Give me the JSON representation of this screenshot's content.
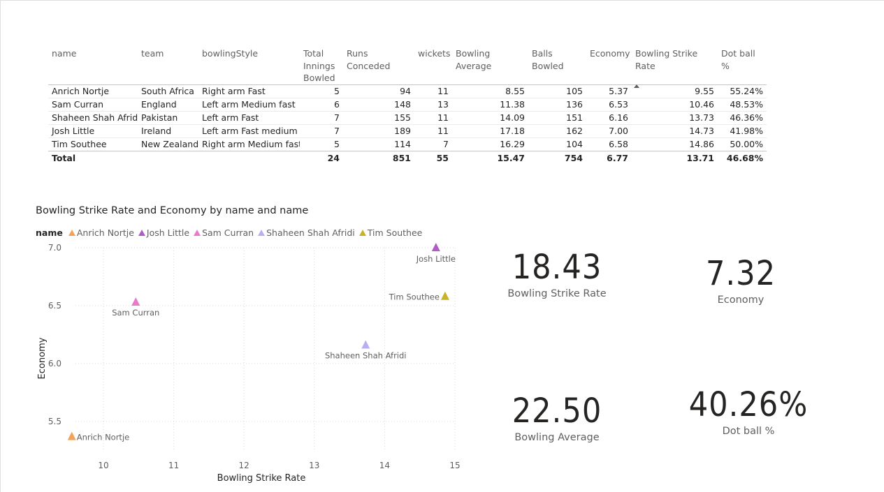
{
  "table": {
    "columns": [
      "name",
      "team",
      "bowlingStyle",
      "Total Innings Bowled",
      "Runs Conceded",
      "wickets",
      "Bowling Average",
      "Balls Bowled",
      "Economy",
      "Bowling Strike Rate",
      "Dot ball %"
    ],
    "rows": [
      [
        "Anrich Nortje",
        "South Africa",
        "Right arm Fast",
        "5",
        "94",
        "11",
        "8.55",
        "105",
        "5.37",
        "9.55",
        "55.24%"
      ],
      [
        "Sam Curran",
        "England",
        "Left arm Medium fast",
        "6",
        "148",
        "13",
        "11.38",
        "136",
        "6.53",
        "10.46",
        "48.53%"
      ],
      [
        "Shaheen Shah Afridi",
        "Pakistan",
        "Left arm Fast",
        "7",
        "155",
        "11",
        "14.09",
        "151",
        "6.16",
        "13.73",
        "46.36%"
      ],
      [
        "Josh Little",
        "Ireland",
        "Left arm Fast medium",
        "7",
        "189",
        "11",
        "17.18",
        "162",
        "7.00",
        "14.73",
        "41.98%"
      ],
      [
        "Tim Southee",
        "New Zealand",
        "Right arm Medium fast",
        "5",
        "114",
        "7",
        "16.29",
        "104",
        "6.58",
        "14.86",
        "50.00%"
      ]
    ],
    "total": [
      "Total",
      "",
      "",
      "24",
      "851",
      "55",
      "15.47",
      "754",
      "6.77",
      "13.71",
      "46.68%"
    ]
  },
  "chart": {
    "title": "Bowling Strike Rate and Economy by name and name",
    "legend_title": "name",
    "legend": [
      "Anrich Nortje",
      "Josh Little",
      "Sam Curran",
      "Shaheen Shah Afridi",
      "Tim Southee"
    ]
  },
  "chart_data": {
    "type": "scatter",
    "title": "Bowling Strike Rate and Economy by name and name",
    "xlabel": "Bowling Strike Rate",
    "ylabel": "Economy",
    "xlim": [
      9.5,
      15
    ],
    "ylim": [
      5.25,
      7.0
    ],
    "xticks": [
      "10",
      "11",
      "12",
      "13",
      "14",
      "15"
    ],
    "yticks": [
      "5.5",
      "6.0",
      "6.5",
      "7.0"
    ],
    "grid": true,
    "legend_position": "top-left",
    "series": [
      {
        "name": "Anrich Nortje",
        "color": "#F2A25B",
        "x": 9.55,
        "y": 5.37
      },
      {
        "name": "Josh Little",
        "color": "#B05CC7",
        "x": 14.73,
        "y": 7.0
      },
      {
        "name": "Sam Curran",
        "color": "#E87BC9",
        "x": 10.46,
        "y": 6.53
      },
      {
        "name": "Shaheen Shah Afridi",
        "color": "#B8AEF0",
        "x": 13.73,
        "y": 6.16
      },
      {
        "name": "Tim Southee",
        "color": "#C9B227",
        "x": 14.86,
        "y": 6.58
      }
    ]
  },
  "cards": [
    {
      "value": "18.43",
      "label": "Bowling Strike Rate"
    },
    {
      "value": "7.32",
      "label": "Economy"
    },
    {
      "value": "22.50",
      "label": "Bowling Average"
    },
    {
      "value": "40.26%",
      "label": "Dot ball %"
    }
  ]
}
